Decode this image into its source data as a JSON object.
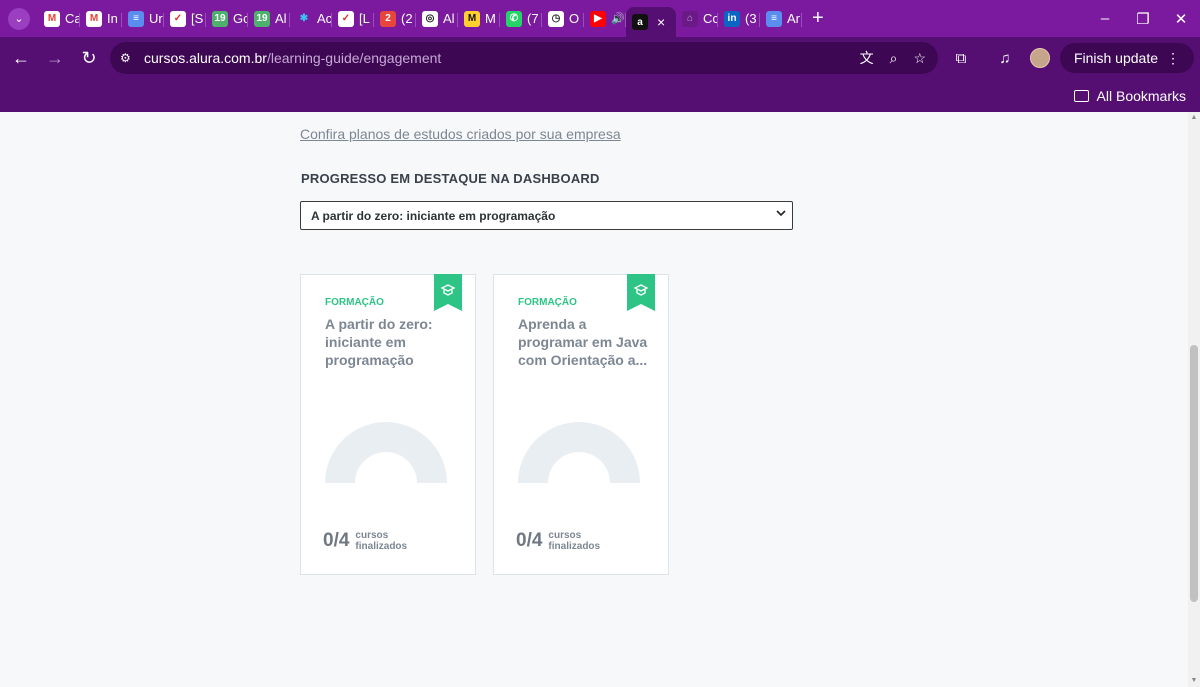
{
  "browser": {
    "tabs": [
      {
        "title": "Ca",
        "icon": "gmail-icon",
        "color": "#ffffff",
        "glyph": "M",
        "glyph_color": "#ea4335"
      },
      {
        "title": "In",
        "icon": "gmail-icon",
        "color": "#ffffff",
        "glyph": "M",
        "glyph_color": "#ea4335"
      },
      {
        "title": "Ur",
        "icon": "docs-icon",
        "color": "#5b8def",
        "glyph": "≡",
        "glyph_color": "#ffffff"
      },
      {
        "title": "[S",
        "icon": "calendar-icon",
        "color": "#ffffff",
        "glyph": "✓",
        "glyph_color": "#d93025"
      },
      {
        "title": "Gc",
        "icon": "meet-icon",
        "color": "#4fb06d",
        "glyph": "19",
        "glyph_color": "#ffffff"
      },
      {
        "title": "Al",
        "icon": "meet-icon",
        "color": "#4fb06d",
        "glyph": "19",
        "glyph_color": "#ffffff"
      },
      {
        "title": "Ac",
        "icon": "slack-icon",
        "color": "#7b1a9e",
        "glyph": "✱",
        "glyph_color": "#36c5f0"
      },
      {
        "title": "[L",
        "icon": "calendar-icon",
        "color": "#ffffff",
        "glyph": "✓",
        "glyph_color": "#d93025"
      },
      {
        "title": "(2",
        "icon": "notification-icon",
        "color": "#e8453c",
        "glyph": "2",
        "glyph_color": "#ffffff"
      },
      {
        "title": "Al",
        "icon": "chatgpt-icon",
        "color": "#ffffff",
        "glyph": "◎",
        "glyph_color": "#222222"
      },
      {
        "title": "M",
        "icon": "miro-icon",
        "color": "#ffd02f",
        "glyph": "M",
        "glyph_color": "#111111"
      },
      {
        "title": "(7",
        "icon": "whatsapp-icon",
        "color": "#25d366",
        "glyph": "✆",
        "glyph_color": "#ffffff"
      },
      {
        "title": "O",
        "icon": "clock-icon",
        "color": "#ffffff",
        "glyph": "◷",
        "glyph_color": "#333333"
      },
      {
        "title": "",
        "icon": "youtube-icon",
        "color": "#ff0000",
        "glyph": "▶",
        "glyph_color": "#ffffff",
        "audio": "🔊"
      },
      {
        "title": "",
        "icon": "alura-icon",
        "color": "#111111",
        "glyph": "a",
        "glyph_color": "#ffffff",
        "active": true,
        "close": "×"
      },
      {
        "title": "Cc",
        "icon": "github-icon",
        "color": "#6a1a86",
        "glyph": "⌂",
        "glyph_color": "#c9a0d9"
      },
      {
        "title": "(3",
        "icon": "linkedin-icon",
        "color": "#0a66c2",
        "glyph": "in",
        "glyph_color": "#ffffff"
      },
      {
        "title": "Ar",
        "icon": "docs-icon",
        "color": "#5b8def",
        "glyph": "≡",
        "glyph_color": "#ffffff"
      }
    ],
    "new_tab": "+",
    "url_domain": "cursos.alura.com.br",
    "url_path": "/learning-guide/engagement",
    "finish_update": "Finish update",
    "all_bookmarks": "All Bookmarks"
  },
  "page": {
    "plans_link": "Confira planos de estudos criados por sua empresa",
    "section_title": "PROGRESSO EM DESTAQUE NA DASHBOARD",
    "select_value": "A partir do zero: iniciante em programação",
    "cards": [
      {
        "kind": "FORMAÇÃO",
        "title": "A partir do zero: iniciante em programação",
        "count": "0/4",
        "count_label_1": "cursos",
        "count_label_2": "finalizados",
        "progress": 0
      },
      {
        "kind": "FORMAÇÃO",
        "title": "Aprenda a programar em Java com Orientação a...",
        "count": "0/4",
        "count_label_1": "cursos",
        "count_label_2": "finalizados",
        "progress": 0
      }
    ]
  },
  "colors": {
    "browser_frame": "#7b1a9e",
    "toolbar": "#550f72",
    "accent_green": "#2ec486",
    "gauge_track": "#e9eef2"
  }
}
